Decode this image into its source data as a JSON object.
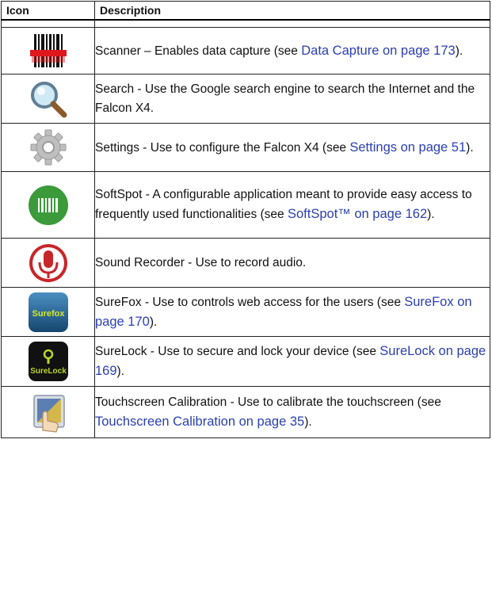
{
  "table": {
    "headers": {
      "icon": "Icon",
      "description": "Description"
    },
    "rows": [
      {
        "icon": "scanner-icon",
        "text_before": "Scanner – Enables data capture (see ",
        "link": "Data Capture on page 173",
        "text_after": ")."
      },
      {
        "icon": "search-magnifier-icon",
        "text_before": "Search - Use the Google search engine to search the Internet and the Falcon X4.",
        "link": "",
        "text_after": ""
      },
      {
        "icon": "settings-gear-icon",
        "text_before": "Settings - Use to configure the Falcon X4 (see ",
        "link": "Settings on page 51",
        "text_after": ")."
      },
      {
        "icon": "softspot-barcode-icon",
        "text_before": "SoftSpot - A configurable application meant to provide easy access to frequently used functionalities (see ",
        "link": "SoftSpot™ on page 162",
        "text_after": ")."
      },
      {
        "icon": "microphone-icon",
        "text_before": "Sound Recorder - Use to record audio.",
        "link": "",
        "text_after": ""
      },
      {
        "icon": "surefox-icon",
        "icon_text": "Surefox",
        "text_before": "SureFox - Use to controls web access for the users (see ",
        "link": "SureFox on page 170",
        "text_after": ")."
      },
      {
        "icon": "surelock-icon",
        "icon_text": "SureLock",
        "text_before": "SureLock - Use to secure and lock your device (see ",
        "link": "SureLock on page 169",
        "text_after": ")."
      },
      {
        "icon": "touchscreen-calibration-icon",
        "text_before": "Touchscreen Calibration - Use to calibrate the touchscreen (see ",
        "link": "Touchscreen Calibration on page 35",
        "text_after": ")."
      }
    ]
  },
  "colors": {
    "border": "#222222",
    "link": "#2a3fb0",
    "softspot_green": "#3b9a3a",
    "recorder_red": "#c6262a",
    "surefox_blue": "#1f5f8e",
    "surelock_black": "#111111"
  }
}
